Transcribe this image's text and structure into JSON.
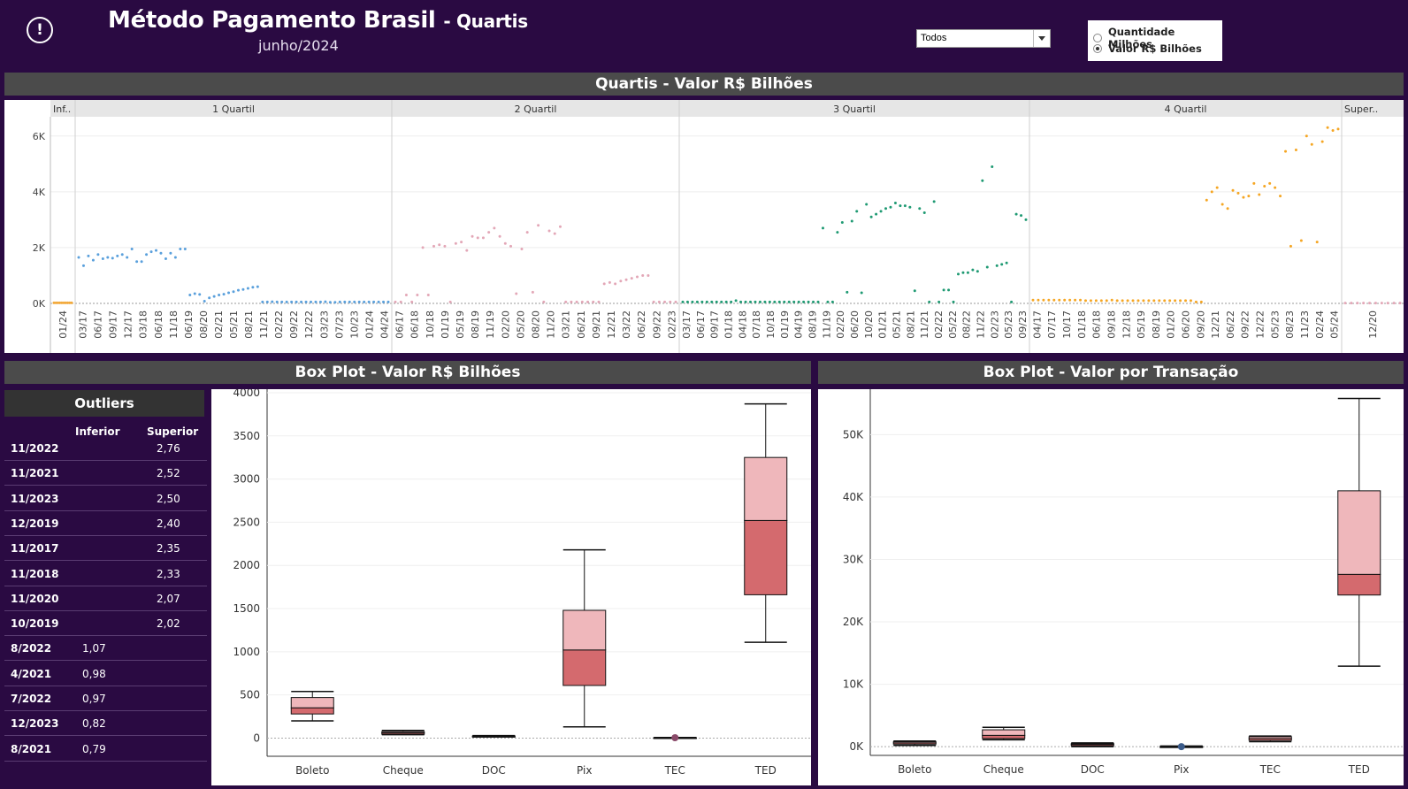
{
  "header": {
    "title": "Método Pagamento Brasil",
    "title_suffix": "- Quartis",
    "subtitle": "junho/2024"
  },
  "filter": {
    "selected": "Todos"
  },
  "measure_toggle": {
    "options": [
      {
        "label": "Quantidade Milhões",
        "selected": false
      },
      {
        "label": "Valor R$ Bilhões",
        "selected": true
      }
    ]
  },
  "sections": {
    "quartis_title": "Quartis - Valor R$ Bilhões",
    "boxplot_title": "Box Plot - Valor R$ Bilhões",
    "boxplot_tx_title": "Box Plot - Valor por Transação"
  },
  "outliers": {
    "title": "Outliers",
    "col_inferior": "Inferior",
    "col_superior": "Superior",
    "rows": [
      {
        "label": "11/2022",
        "inferior": "",
        "superior": "2,76"
      },
      {
        "label": "11/2021",
        "inferior": "",
        "superior": "2,52"
      },
      {
        "label": "11/2023",
        "inferior": "",
        "superior": "2,50"
      },
      {
        "label": "12/2019",
        "inferior": "",
        "superior": "2,40"
      },
      {
        "label": "11/2017",
        "inferior": "",
        "superior": "2,35"
      },
      {
        "label": "11/2018",
        "inferior": "",
        "superior": "2,33"
      },
      {
        "label": "11/2020",
        "inferior": "",
        "superior": "2,07"
      },
      {
        "label": "10/2019",
        "inferior": "",
        "superior": "2,02"
      },
      {
        "label": "8/2022",
        "inferior": "1,07",
        "superior": ""
      },
      {
        "label": "4/2021",
        "inferior": "0,98",
        "superior": ""
      },
      {
        "label": "7/2022",
        "inferior": "0,97",
        "superior": ""
      },
      {
        "label": "12/2023",
        "inferior": "0,82",
        "superior": ""
      },
      {
        "label": "8/2021",
        "inferior": "0,79",
        "superior": ""
      }
    ]
  },
  "colors": {
    "background": "#2a0a42",
    "section_bar": "#4b4b4b",
    "q1": "#5aa0dc",
    "q2": "#e3a7b7",
    "q3": "#1f9a73",
    "q4": "#f5a623",
    "inf_super": "#f2a93b",
    "box_light": "#efb7bb",
    "box_dark": "#d46a6e"
  },
  "chart_data": [
    {
      "type": "scatter",
      "title": "Quartis - Valor R$ Bilhões",
      "panels": [
        "Inf..",
        "1 Quartil",
        "2 Quartil",
        "3 Quartil",
        "4 Quartil",
        "Super.."
      ],
      "y_ticks": [
        "0K",
        "2K",
        "4K",
        "6K"
      ],
      "ylim": [
        0,
        6500
      ],
      "x_ticks": [
        [
          "01/24"
        ],
        [
          "03/17",
          "06/17",
          "09/17",
          "12/17",
          "03/18",
          "06/18",
          "11/18",
          "06/19",
          "08/20",
          "02/21",
          "05/21",
          "08/21",
          "11/21",
          "02/22",
          "09/22",
          "12/22",
          "03/23",
          "07/23",
          "10/23",
          "01/24",
          "04/24"
        ],
        [
          "06/17",
          "06/18",
          "10/18",
          "01/19",
          "05/19",
          "08/19",
          "11/19",
          "02/20",
          "05/20",
          "08/20",
          "11/20",
          "03/21",
          "06/21",
          "09/21",
          "12/21",
          "03/22",
          "06/22",
          "09/22",
          "02/23"
        ],
        [
          "03/17",
          "06/17",
          "09/17",
          "01/18",
          "04/18",
          "07/18",
          "10/18",
          "01/19",
          "04/19",
          "08/19",
          "11/19",
          "02/20",
          "06/20",
          "10/20",
          "01/21",
          "05/21",
          "08/21",
          "11/21",
          "02/22",
          "05/22",
          "08/22",
          "11/22",
          "02/23",
          "05/23",
          "09/23"
        ],
        [
          "04/17",
          "07/17",
          "10/17",
          "01/18",
          "06/18",
          "09/18",
          "12/18",
          "05/19",
          "08/19",
          "01/20",
          "06/20",
          "09/20",
          "12/21",
          "06/22",
          "09/22",
          "12/22",
          "05/23",
          "08/23",
          "11/23",
          "02/24",
          "05/24"
        ],
        [
          "12/20"
        ]
      ],
      "series": [
        {
          "name": "Inf..",
          "values": [
            20,
            20,
            20,
            20,
            20,
            20,
            20,
            20,
            20,
            20
          ]
        },
        {
          "name": "1 Quartil",
          "values": [
            1650,
            1350,
            1700,
            1550,
            1750,
            1600,
            1650,
            1620,
            1700,
            1750,
            1650,
            1950,
            1500,
            1500,
            1750,
            1850,
            1900,
            1800,
            1600,
            1800,
            1650,
            1950,
            1950,
            300,
            350,
            320,
            80,
            200,
            250,
            300,
            330,
            380,
            420,
            470,
            500,
            540,
            580,
            600,
            50,
            50,
            60,
            50,
            50,
            50,
            50,
            50,
            50,
            50,
            50,
            50,
            50,
            60,
            40,
            40,
            50,
            50,
            50,
            50,
            50,
            50,
            50,
            50,
            50,
            50,
            50
          ]
        },
        {
          "name": "2 Quartil",
          "values": [
            50,
            50,
            300,
            50,
            300,
            2000,
            300,
            2050,
            2100,
            2050,
            50,
            2150,
            2200,
            1900,
            2400,
            2350,
            2350,
            2550,
            2700,
            2400,
            2150,
            2050,
            350,
            1950,
            2550,
            400,
            2800,
            50,
            2600,
            2500,
            2750,
            50,
            50,
            50,
            50,
            50,
            50,
            50,
            700,
            750,
            700,
            800,
            850,
            900,
            950,
            1000,
            1000,
            50,
            50,
            50,
            50,
            50
          ]
        },
        {
          "name": "3 Quartil",
          "values": [
            50,
            50,
            50,
            50,
            50,
            50,
            50,
            50,
            50,
            50,
            50,
            100,
            50,
            50,
            50,
            50,
            50,
            50,
            50,
            50,
            50,
            50,
            50,
            50,
            50,
            50,
            50,
            50,
            50,
            2700,
            50,
            50,
            2550,
            2900,
            400,
            2950,
            3300,
            380,
            3550,
            3100,
            3200,
            3300,
            3400,
            3450,
            3600,
            3500,
            3500,
            3450,
            450,
            3400,
            3250,
            50,
            3650,
            50,
            480,
            480,
            50,
            1050,
            1100,
            1100,
            1200,
            1150,
            4400,
            1300,
            4900,
            1350,
            1400,
            1450,
            50,
            3200,
            3150,
            3000
          ]
        },
        {
          "name": "4 Quartil",
          "values": [
            120,
            120,
            120,
            120,
            120,
            120,
            120,
            120,
            120,
            120,
            100,
            100,
            100,
            100,
            100,
            120,
            100,
            100,
            100,
            100,
            100,
            100,
            100,
            100,
            100,
            100,
            100,
            100,
            100,
            100,
            100,
            50,
            50,
            3700,
            4000,
            4150,
            3550,
            3400,
            4050,
            3950,
            3800,
            3850,
            4300,
            3900,
            4200,
            4300,
            4150,
            3850,
            5450,
            2050,
            5500,
            2250,
            6000,
            5700,
            2200,
            5800,
            6300,
            6200,
            6250
          ]
        },
        {
          "name": "Super..",
          "values": [
            10,
            10,
            10,
            10,
            10,
            10,
            10,
            10,
            10,
            10
          ]
        }
      ]
    },
    {
      "type": "boxplot",
      "title": "Box Plot - Valor R$ Bilhões",
      "categories": [
        "Boleto",
        "Cheque",
        "DOC",
        "Pix",
        "TEC",
        "TED"
      ],
      "y_ticks": [
        "0",
        "500",
        "1000",
        "1500",
        "2000",
        "2500",
        "3000",
        "3500",
        "4000"
      ],
      "ylim": [
        -210,
        4020
      ],
      "boxes": [
        {
          "min": 200,
          "q1": 280,
          "median": 350,
          "q3": 470,
          "max": 540
        },
        {
          "min": 40,
          "q1": 45,
          "median": 60,
          "q3": 75,
          "max": 90
        },
        {
          "min": 15,
          "q1": 20,
          "median": 22,
          "q3": 25,
          "max": 30
        },
        {
          "min": 130,
          "q1": 610,
          "median": 1020,
          "q3": 1480,
          "max": 2180
        },
        {
          "min": 3,
          "q1": 5,
          "median": 5,
          "q3": 6,
          "max": 8
        },
        {
          "min": 1110,
          "q1": 1660,
          "median": 2520,
          "q3": 3250,
          "max": 3870
        }
      ]
    },
    {
      "type": "boxplot",
      "title": "Box Plot - Valor por Transação",
      "categories": [
        "Boleto",
        "Cheque",
        "DOC",
        "Pix",
        "TEC",
        "TED"
      ],
      "y_ticks": [
        "0K",
        "10K",
        "20K",
        "30K",
        "40K",
        "50K"
      ],
      "ylim": [
        -1400,
        57000
      ],
      "boxes": [
        {
          "min": 200,
          "q1": 400,
          "median": 600,
          "q3": 800,
          "max": 900
        },
        {
          "min": 1100,
          "q1": 1300,
          "median": 1800,
          "q3": 2700,
          "max": 3100
        },
        {
          "min": 0,
          "q1": 150,
          "median": 350,
          "q3": 500,
          "max": 600
        },
        {
          "min": -100,
          "q1": -50,
          "median": 0,
          "q3": 50,
          "max": 100
        },
        {
          "min": 800,
          "q1": 1000,
          "median": 1300,
          "q3": 1600,
          "max": 1700
        },
        {
          "min": 12900,
          "q1": 24300,
          "median": 27600,
          "q3": 41000,
          "max": 55800
        }
      ]
    }
  ]
}
